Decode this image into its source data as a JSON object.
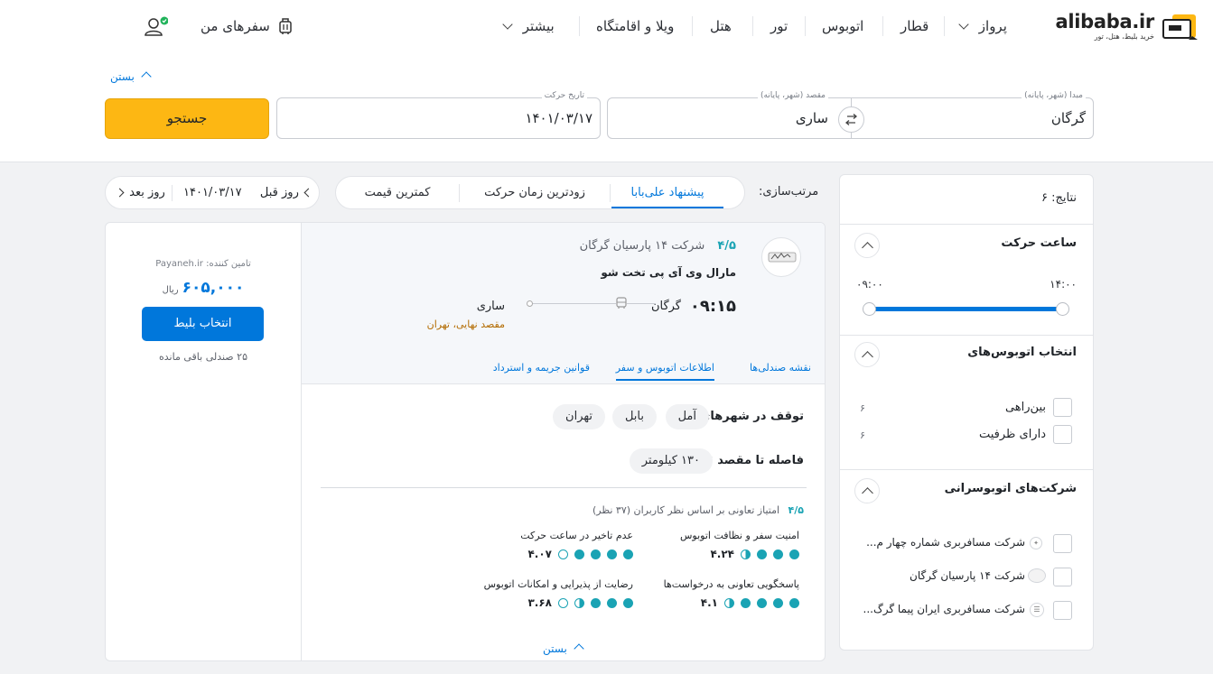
{
  "brand": {
    "name": "alibaba.ir",
    "tagline": "خرید بلیط، هتل، تور"
  },
  "nav": {
    "items": [
      {
        "label": "پرواز"
      },
      {
        "label": "قطار"
      },
      {
        "label": "اتوبوس"
      },
      {
        "label": "تور"
      },
      {
        "label": "هتل"
      },
      {
        "label": "ویلا و اقامتگاه"
      },
      {
        "label": "بیشتر"
      }
    ],
    "my_trips": "سفرهای من"
  },
  "search": {
    "close_label": "بستن",
    "origin": {
      "label": "مبدا (شهر، پایانه)",
      "value": "گرگان"
    },
    "destination": {
      "label": "مقصد (شهر، پایانه)",
      "value": "ساری"
    },
    "date": {
      "label": "تاریخ حرکت",
      "value": "۱۴۰۱/۰۳/۱۷"
    },
    "button": "جستجو"
  },
  "sort": {
    "label": "مرتب‌سازی:",
    "options": [
      "پیشنهاد علی‌بابا",
      "زودترین زمان حرکت",
      "کمترین قیمت"
    ],
    "active_index": 0
  },
  "day_nav": {
    "prev": "روز قبل",
    "date": "۱۴۰۱/۰۳/۱۷",
    "next": "روز بعد"
  },
  "filters": {
    "results": "نتایج: ۶",
    "departure_time": {
      "title": "ساعت حرکت",
      "from": "۰۹:۰۰",
      "to": "۱۴:۰۰"
    },
    "bus_type": {
      "title": "انتخاب اتوبوس‌های",
      "options": [
        {
          "label": "بین‌راهی",
          "count": "۶"
        },
        {
          "label": "دارای ظرفیت",
          "count": "۶"
        }
      ]
    },
    "companies": {
      "title": "شرکت‌های اتوبوسرانی",
      "options": [
        {
          "label": "شرکت مسافربری شماره چهار م..."
        },
        {
          "label": "شرکت ۱۴ پارسیان گرگان"
        },
        {
          "label": "شرکت مسافربری ایران پیما گرگ..."
        }
      ]
    }
  },
  "ticket": {
    "company": "شرکت ۱۴ پارسیان گرگان",
    "rating": "۴/۵",
    "bus_name": "مارال وی آی پی تخت شو",
    "time": "۰۹:۱۵",
    "from": "گرگان",
    "to": "ساری",
    "final_destination": "مقصد نهایی، تهران",
    "provider": "تامین کننده: Payaneh.ir",
    "price": "۶۰۵,۰۰۰",
    "currency": "ریال",
    "select_button": "انتخاب بلیط",
    "seats_left": "۲۵ صندلی باقی مانده",
    "tabs": [
      "نقشه صندلی‌ها",
      "اطلاعات اتوبوس و سفر",
      "قوانین جریمه و استرداد"
    ],
    "active_tab": 1,
    "stops_label": "توقف در شهرهای :",
    "stops": [
      "آمل",
      "بابل",
      "تهران"
    ],
    "distance_label": "فاصله تا مقصد :",
    "distance": "۱۳۰ کیلومتر",
    "coop_rating": "۴/۵",
    "coop_text": "امتیاز تعاونی بر اساس نظر کاربران (۳۷ نظر)",
    "metrics": [
      {
        "label": "امنیت سفر و نظافت اتوبوس",
        "value": "۴.۲۴",
        "full": 3,
        "half": 1,
        "empty": 0
      },
      {
        "label": "عدم تاخیر در ساعت حرکت",
        "value": "۴.۰۷",
        "full": 4,
        "half": 0,
        "empty": 1
      },
      {
        "label": "پاسخگویی تعاونی به درخواست‌ها",
        "value": "۴.۱",
        "full": 4,
        "half": 1,
        "empty": 0
      },
      {
        "label": "رضایت از پذیرایی و امکانات اتوبوس",
        "value": "۳.۶۸",
        "full": 3,
        "half": 1,
        "empty": 1
      }
    ],
    "close_label": "بستن"
  },
  "colors": {
    "primary": "#0077db",
    "accent": "#fdb713",
    "rating": "#1aa3b4"
  }
}
